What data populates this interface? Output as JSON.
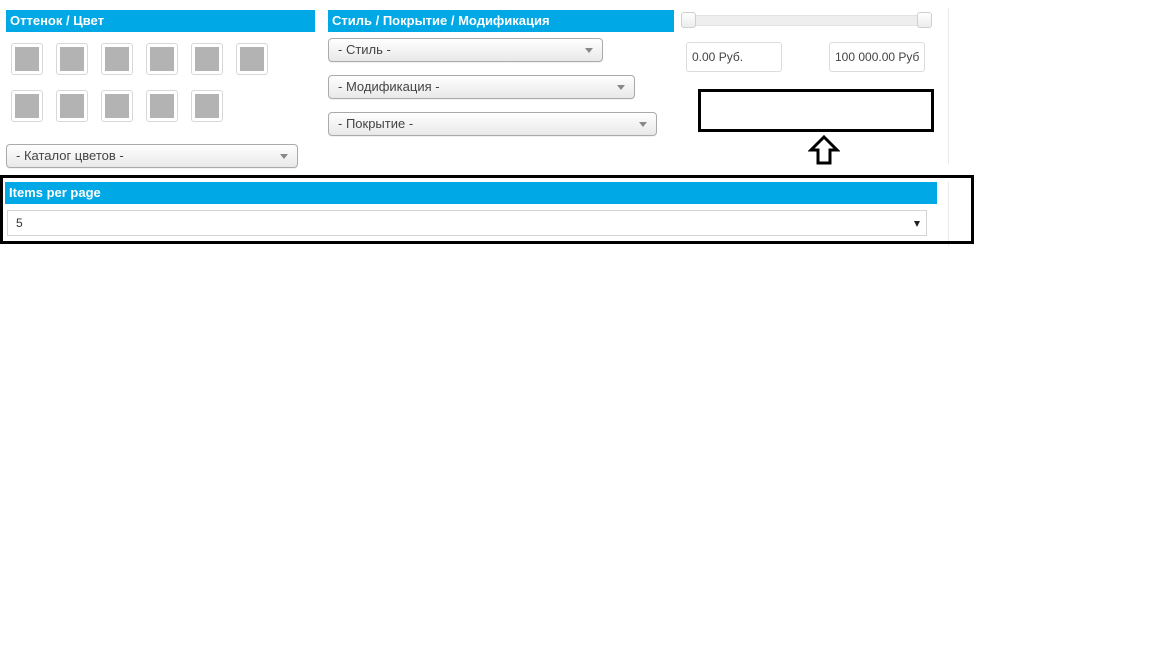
{
  "color_filter": {
    "header": "Оттенок / Цвет",
    "swatch_count": 11,
    "catalog_select": "- Каталог цветов -"
  },
  "style_filter": {
    "header": "Стиль / Покрытие / Модификация",
    "style_select": "- Стиль -",
    "modification_select": "- Модификация -",
    "coating_select": "- Покрытие -"
  },
  "price_filter": {
    "min_value": "0.00 Руб.",
    "max_value": "100 000.00 Руб"
  },
  "items_per_page": {
    "header": "Items per page",
    "selected": "5"
  },
  "colors": {
    "header_bg": "#00a8e6",
    "swatch_fill": "#b3b3b3"
  }
}
